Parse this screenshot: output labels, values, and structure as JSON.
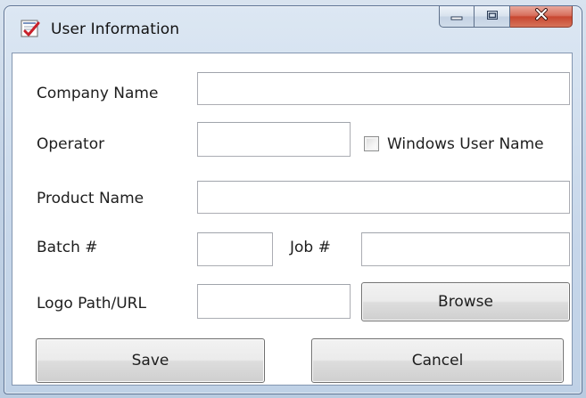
{
  "window": {
    "title": "User Information"
  },
  "form": {
    "company_name": {
      "label": "Company Name",
      "value": ""
    },
    "operator": {
      "label": "Operator",
      "value": ""
    },
    "windows_user_name": {
      "label": "Windows User Name",
      "checked": false
    },
    "product_name": {
      "label": "Product Name",
      "value": ""
    },
    "batch": {
      "label": "Batch #",
      "value": ""
    },
    "job": {
      "label": "Job #",
      "value": ""
    },
    "logo_path": {
      "label": "Logo Path/URL",
      "value": ""
    }
  },
  "buttons": {
    "browse": "Browse",
    "save": "Save",
    "cancel": "Cancel"
  },
  "icons": {
    "app": "app-document-check-icon",
    "minimize": "minimize-icon",
    "maximize": "maximize-icon",
    "close": "close-icon"
  },
  "colors": {
    "frame": "#c7d7ea",
    "close_button": "#c84730",
    "client_background": "#ffffff"
  }
}
